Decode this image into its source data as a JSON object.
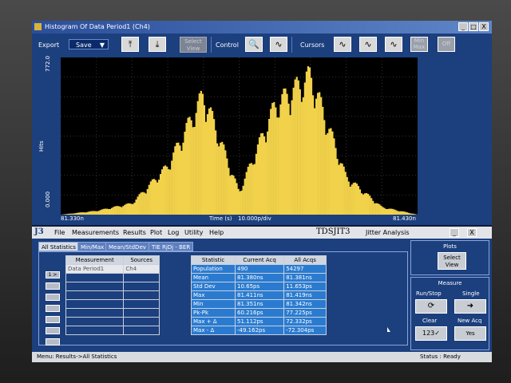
{
  "window": {
    "title": "Histogram Of Data Period1 (Ch4)",
    "buttons": [
      "_",
      "□",
      "X"
    ]
  },
  "toolbar": {
    "export_label": "Export",
    "save_label": "Save",
    "select_view_label": "Select View",
    "control_label": "Control",
    "cursors_label": "Cursors",
    "min_max_label": "Min Max",
    "off_label": "Off"
  },
  "chart_data": {
    "type": "bar",
    "title": "",
    "xlabel": "Time (s)",
    "ylabel": "Hits",
    "x_range_label": [
      "81.330n",
      "81.430n"
    ],
    "x_scale": "10.000p/div",
    "ylim": [
      0.0,
      772.0
    ],
    "y_tick_labels": [
      "0.000",
      "772.0"
    ],
    "grid": true,
    "bar_color": "#f2d24b",
    "x_bins": [
      81.33,
      81.34,
      81.35,
      81.36,
      81.37,
      81.38,
      81.39,
      81.4,
      81.41,
      81.42,
      81.43
    ],
    "values": [
      0,
      20,
      60,
      260,
      640,
      120,
      580,
      740,
      200,
      40,
      0
    ]
  },
  "app": {
    "logo": "J3",
    "menus": [
      "File",
      "Measurements",
      "Results",
      "Plot",
      "Log",
      "Utility",
      "Help"
    ],
    "brand": "TDSJIT3",
    "subtitle": "Jitter Analysis",
    "tabs": [
      "All Statistics",
      "Min/Max",
      "Mean/StdDev",
      "TIE RjDj - BER"
    ],
    "row_buttons": [
      "1 >",
      "",
      "",
      "",
      "",
      "",
      ""
    ],
    "measurements": {
      "headers": [
        "Measurement",
        "Sources"
      ],
      "rows": [
        [
          "Data Period1",
          "Ch4"
        ],
        [
          "",
          ""
        ],
        [
          "",
          ""
        ],
        [
          "",
          ""
        ],
        [
          "",
          ""
        ],
        [
          "",
          ""
        ],
        [
          "",
          ""
        ],
        [
          "",
          ""
        ]
      ]
    },
    "statistics": {
      "headers": [
        "Statistic",
        "Current Acq",
        "All Acqs"
      ],
      "rows": [
        [
          "Population",
          "490",
          "54297"
        ],
        [
          "Mean",
          "81.380ns",
          "81.381ns"
        ],
        [
          "Std Dev",
          "10.65ps",
          "11.653ps"
        ],
        [
          "Max",
          "81.411ns",
          "81.419ns"
        ],
        [
          "Min",
          "81.351ns",
          "81.342ns"
        ],
        [
          "Pk-Pk",
          "60.216ps",
          "77.225ps"
        ],
        [
          "Max + Δ",
          "51.112ps",
          "72.332ps"
        ],
        [
          "Max - Δ",
          "-49.162ps",
          "-72.304ps"
        ]
      ]
    },
    "right_panel": {
      "plots_label": "Plots",
      "select_view": "Select View",
      "measure_label": "Measure",
      "run_stop": "Run/Stop",
      "single": "Single",
      "clear": "Clear",
      "new_acq": "New Acq",
      "yes": "Yes"
    },
    "status_left": "Menu: Results->All Statistics",
    "status_right": "Status : Ready"
  }
}
